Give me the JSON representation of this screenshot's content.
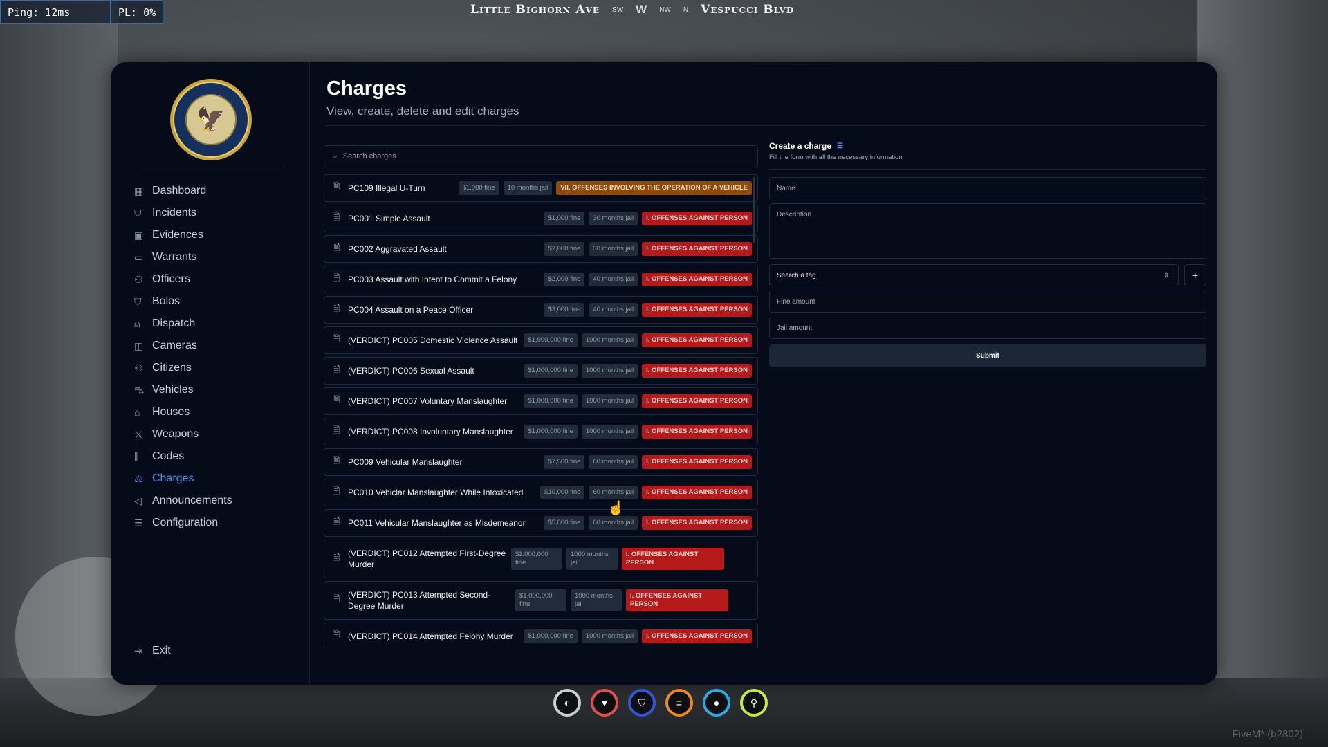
{
  "hud": {
    "ping": "Ping: 12ms",
    "packet_loss": "PL: 0%",
    "street_left": "Little Bighorn Ave",
    "street_right": "Vespucci Blvd",
    "compass": [
      "SW",
      "W",
      "NW",
      "N"
    ],
    "status_rings": [
      {
        "name": "voice",
        "color": "#cccccc",
        "icon": "speaker-icon"
      },
      {
        "name": "health",
        "color": "#e05050",
        "icon": "heart-icon"
      },
      {
        "name": "armor",
        "color": "#2f58d8",
        "icon": "shield-icon"
      },
      {
        "name": "hunger",
        "color": "#e88a1c",
        "icon": "burger-icon"
      },
      {
        "name": "thirst",
        "color": "#2fa9e6",
        "icon": "drop-icon"
      },
      {
        "name": "stamina",
        "color": "#c4e84a",
        "icon": "running-icon"
      }
    ],
    "watermark": "FiveM* (b2802)"
  },
  "sidebar": {
    "logo_text": "LOS SANTOS POLICE DEPARTMENT",
    "items": [
      {
        "label": "Dashboard",
        "icon": "grid-icon"
      },
      {
        "label": "Incidents",
        "icon": "shield-icon"
      },
      {
        "label": "Evidences",
        "icon": "image-icon"
      },
      {
        "label": "Warrants",
        "icon": "folder-icon"
      },
      {
        "label": "Officers",
        "icon": "users-icon"
      },
      {
        "label": "Bolos",
        "icon": "shield-icon"
      },
      {
        "label": "Dispatch",
        "icon": "siren-icon"
      },
      {
        "label": "Cameras",
        "icon": "camera-icon"
      },
      {
        "label": "Citizens",
        "icon": "users-icon"
      },
      {
        "label": "Vehicles",
        "icon": "car-icon"
      },
      {
        "label": "Houses",
        "icon": "home-icon"
      },
      {
        "label": "Weapons",
        "icon": "crossed-swords-icon"
      },
      {
        "label": "Codes",
        "icon": "audio-lines-icon"
      },
      {
        "label": "Charges",
        "icon": "gavel-icon",
        "active": true
      },
      {
        "label": "Announcements",
        "icon": "megaphone-icon"
      },
      {
        "label": "Configuration",
        "icon": "sliders-icon"
      }
    ],
    "exit_label": "Exit"
  },
  "header": {
    "title": "Charges",
    "subtitle": "View, create, delete and edit charges"
  },
  "search": {
    "placeholder": "Search charges"
  },
  "charges": [
    {
      "name": "PC109 Illegal U-Turn",
      "fine": "$1,000 fine",
      "jail": "10 months jail",
      "tag": "VII. OFFENSES INVOLVING THE OPERATION OF A VEHICLE",
      "tag_color": "#8c4a0c"
    },
    {
      "name": "PC001 Simple Assault",
      "fine": "$1,000 fine",
      "jail": "30 months jail",
      "tag": "I. OFFENSES AGAINST PERSON"
    },
    {
      "name": "PC002 Aggravated Assault",
      "fine": "$2,000 fine",
      "jail": "30 months jail",
      "tag": "I. OFFENSES AGAINST PERSON"
    },
    {
      "name": "PC003 Assault with Intent to Commit a Felony",
      "fine": "$2,000 fine",
      "jail": "40 months jail",
      "tag": "I. OFFENSES AGAINST PERSON"
    },
    {
      "name": "PC004 Assault on a Peace Officer",
      "fine": "$3,000 fine",
      "jail": "40 months jail",
      "tag": "I. OFFENSES AGAINST PERSON"
    },
    {
      "name": "(VERDICT) PC005 Domestic Violence Assault",
      "fine": "$1,000,000 fine",
      "jail": "1000 months jail",
      "tag": "I. OFFENSES AGAINST PERSON"
    },
    {
      "name": "(VERDICT) PC006 Sexual Assault",
      "fine": "$1,000,000 fine",
      "jail": "1000 months jail",
      "tag": "I. OFFENSES AGAINST PERSON"
    },
    {
      "name": "(VERDICT) PC007 Voluntary Manslaughter",
      "fine": "$1,000,000 fine",
      "jail": "1000 months jail",
      "tag": "I. OFFENSES AGAINST PERSON"
    },
    {
      "name": "(VERDICT) PC008 Involuntary Manslaughter",
      "fine": "$1,000,000 fine",
      "jail": "1000 months jail",
      "tag": "I. OFFENSES AGAINST PERSON"
    },
    {
      "name": "PC009 Vehicular Manslaughter",
      "fine": "$7,500 fine",
      "jail": "60 months jail",
      "tag": "I. OFFENSES AGAINST PERSON"
    },
    {
      "name": "PC010 Vehiclar Manslaughter While Intoxicated",
      "fine": "$10,000 fine",
      "jail": "60 months jail",
      "tag": "I. OFFENSES AGAINST PERSON"
    },
    {
      "name": "PC011 Vehicular Manslaughter as Misdemeanor",
      "fine": "$5,000 fine",
      "jail": "60 months jail",
      "tag": "I. OFFENSES AGAINST PERSON"
    },
    {
      "name": "(VERDICT) PC012 Attempted First-Degree Murder",
      "fine": "$1,000,000 fine",
      "jail": "1000 months jail",
      "tag": "I. OFFENSES AGAINST PERSON",
      "wrap": true
    },
    {
      "name": "(VERDICT) PC013 Attempted Second-Degree Murder",
      "fine": "$1,000,000 fine",
      "jail": "1000 months jail",
      "tag": "I. OFFENSES AGAINST PERSON",
      "wrap": true
    },
    {
      "name": "(VERDICT) PC014 Attempted Felony Murder",
      "fine": "$1,000,000 fine",
      "jail": "1000 months jail",
      "tag": "I. OFFENSES AGAINST PERSON"
    }
  ],
  "form": {
    "title": "Create a charge",
    "subtitle": "Fill the form with all the necessary information",
    "name_placeholder": "Name",
    "description_placeholder": "Description",
    "tag_select": "Search a tag",
    "fine_placeholder": "Fine amount",
    "jail_placeholder": "Jail amount",
    "submit_label": "Submit"
  },
  "colors": {
    "background": "#050b18",
    "accent": "#4d8ff0",
    "tag_red": "#b41a1a",
    "tag_orange": "#8c4a0c"
  }
}
